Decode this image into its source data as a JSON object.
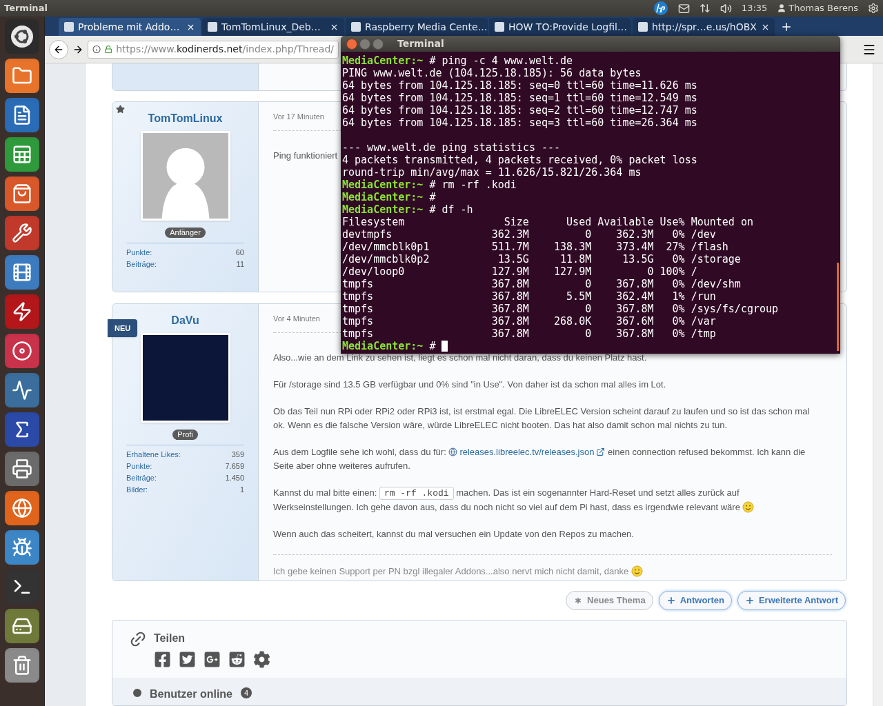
{
  "top_panel": {
    "app_title": "Terminal",
    "time": "13:35",
    "user": "Thomas Berens"
  },
  "browser": {
    "tabs": [
      {
        "label": "Probleme mit Addo…",
        "selected": true
      },
      {
        "label": "TomTomLinux_Deb…",
        "selected": false
      },
      {
        "label": "Raspberry Media Cente…",
        "selected": false
      },
      {
        "label": "HOW TO:Provide Logfil…",
        "selected": false
      },
      {
        "label": "http://spr…e.us/hOBX",
        "selected": false
      }
    ],
    "address": {
      "scheme": "https://www.",
      "domain": "kodinerds.net",
      "path": "/index.php/Thread/"
    }
  },
  "posts": [
    {
      "author": "TomTomLinux",
      "starred": true,
      "new": false,
      "avatar": {
        "kind": "silhouette"
      },
      "rank": "Anfänger",
      "stats": [
        {
          "label": "Punkte:",
          "value": "60"
        },
        {
          "label": "Beiträge:",
          "value": "11"
        }
      ],
      "time": "Vor 17 Minuten",
      "paragraphs": [
        {
          "kind": "text",
          "segments": [
            {
              "kind": "text",
              "text": "Ping funktioniert"
            }
          ]
        }
      ]
    },
    {
      "author": "DaVu",
      "starred": false,
      "new": true,
      "new_label": "NEU",
      "avatar": {
        "kind": "photo"
      },
      "rank": "Profi",
      "stats": [
        {
          "label": "Erhaltene Likes:",
          "value": "359"
        },
        {
          "label": "Punkte:",
          "value": "7.659"
        },
        {
          "label": "Beiträge:",
          "value": "1.450"
        },
        {
          "label": "Bilder:",
          "value": "1"
        }
      ],
      "time": "Vor 4 Minuten",
      "paragraphs": [
        {
          "kind": "text",
          "segments": [
            {
              "kind": "text",
              "text": "Also...wie an dem Link zu sehen ist, liegt es schon mal nicht daran, dass du keinen Platz hast."
            }
          ]
        },
        {
          "kind": "text",
          "segments": [
            {
              "kind": "text",
              "text": "Für /storage sind 13.5 GB verfügbar und 0% sind \"in Use\". Von daher ist da schon mal alles im Lot."
            }
          ]
        },
        {
          "kind": "text",
          "segments": [
            {
              "kind": "text",
              "text": "Ob das Teil nun RPi oder RPi2 oder RPi3 ist, ist erstmal egal. Die LibreELEC Version scheint darauf zu laufen und so ist das schon mal ok. Wenn es die falsche Version wäre, würde LibreELEC nicht booten. Das hat also damit schon mal nichts zu tun."
            }
          ]
        },
        {
          "kind": "text",
          "segments": [
            {
              "kind": "text",
              "text": "Aus dem Logfile sehe ich wohl, dass du für: "
            },
            {
              "kind": "link",
              "text": "releases.libreelec.tv/releases.json"
            },
            {
              "kind": "text",
              "text": " einen connection refused bekommst. Ich kann die Seite aber ohne weiteres aufrufen."
            }
          ]
        },
        {
          "kind": "text",
          "segments": [
            {
              "kind": "text",
              "text": "Kannst du mal bitte einen: "
            },
            {
              "kind": "code",
              "text": "rm -rf .kodi"
            },
            {
              "kind": "text",
              "text": " machen. Das ist ein sogenannter Hard-Reset und setzt alles zurück auf Werkseinstellungen. Ich gehe davon aus, dass du noch nicht so viel auf dem Pi hast, dass es irgendwie relevant wäre "
            },
            {
              "kind": "smiley"
            }
          ]
        },
        {
          "kind": "text",
          "segments": [
            {
              "kind": "text",
              "text": "Wenn auch das scheitert, kannst du mal versuchen ein Update von den Repos zu machen."
            }
          ]
        },
        {
          "kind": "signature",
          "segments": [
            {
              "kind": "text",
              "text": "Ich gebe keinen Support per PN bzgl illegaler Addons...also nervt mich nicht damit, danke "
            },
            {
              "kind": "smiley"
            }
          ]
        }
      ]
    }
  ],
  "actions": [
    {
      "kind": "neutral",
      "label": "Neues Thema"
    },
    {
      "kind": "primary",
      "label": "Antworten"
    },
    {
      "kind": "primary",
      "label": "Erweiterte Antwort"
    }
  ],
  "share": {
    "title": "Teilen"
  },
  "online": {
    "title": "Benutzer online",
    "count": "4"
  },
  "terminal": {
    "title": "Terminal",
    "lines": [
      {
        "kind": "prompt",
        "prompt": "MediaCenter:~",
        "command": "# ping -c 4 www.welt.de"
      },
      {
        "kind": "output",
        "text": "PING www.welt.de (104.125.18.185): 56 data bytes"
      },
      {
        "kind": "output",
        "text": "64 bytes from 104.125.18.185: seq=0 ttl=60 time=11.626 ms"
      },
      {
        "kind": "output",
        "text": "64 bytes from 104.125.18.185: seq=1 ttl=60 time=12.549 ms"
      },
      {
        "kind": "output",
        "text": "64 bytes from 104.125.18.185: seq=2 ttl=60 time=12.747 ms"
      },
      {
        "kind": "output",
        "text": "64 bytes from 104.125.18.185: seq=3 ttl=60 time=26.364 ms"
      },
      {
        "kind": "blank"
      },
      {
        "kind": "output",
        "text": "--- www.welt.de ping statistics ---"
      },
      {
        "kind": "output",
        "text": "4 packets transmitted, 4 packets received, 0% packet loss"
      },
      {
        "kind": "output",
        "text": "round-trip min/avg/max = 11.626/15.821/26.364 ms"
      },
      {
        "kind": "prompt",
        "prompt": "MediaCenter:~",
        "command": "# rm -rf .kodi"
      },
      {
        "kind": "prompt",
        "prompt": "MediaCenter:~",
        "command": "#"
      },
      {
        "kind": "prompt",
        "prompt": "MediaCenter:~",
        "command": "# df -h"
      },
      {
        "kind": "df_row",
        "cells": [
          "Filesystem",
          "Size",
          "Used",
          "Available",
          "Use%",
          "Mounted on"
        ]
      },
      {
        "kind": "df_row",
        "cells": [
          "devtmpfs",
          "362.3M",
          "0",
          "362.3M",
          "0%",
          "/dev"
        ]
      },
      {
        "kind": "df_row",
        "cells": [
          "/dev/mmcblk0p1",
          "511.7M",
          "138.3M",
          "373.4M",
          "27%",
          "/flash"
        ]
      },
      {
        "kind": "df_row",
        "cells": [
          "/dev/mmcblk0p2",
          "13.5G",
          "11.8M",
          "13.5G",
          "0%",
          "/storage"
        ]
      },
      {
        "kind": "df_row",
        "cells": [
          "/dev/loop0",
          "127.9M",
          "127.9M",
          "0",
          "100%",
          "/"
        ]
      },
      {
        "kind": "df_row",
        "cells": [
          "tmpfs",
          "367.8M",
          "0",
          "367.8M",
          "0%",
          "/dev/shm"
        ]
      },
      {
        "kind": "df_row",
        "cells": [
          "tmpfs",
          "367.8M",
          "5.5M",
          "362.4M",
          "1%",
          "/run"
        ]
      },
      {
        "kind": "df_row",
        "cells": [
          "tmpfs",
          "367.8M",
          "0",
          "367.8M",
          "0%",
          "/sys/fs/cgroup"
        ]
      },
      {
        "kind": "df_row",
        "cells": [
          "tmpfs",
          "367.8M",
          "268.0K",
          "367.6M",
          "0%",
          "/var"
        ]
      },
      {
        "kind": "df_row",
        "cells": [
          "tmpfs",
          "367.8M",
          "0",
          "367.8M",
          "0%",
          "/tmp"
        ]
      },
      {
        "kind": "active_prompt",
        "prompt": "MediaCenter:~",
        "command": "#"
      }
    ]
  }
}
